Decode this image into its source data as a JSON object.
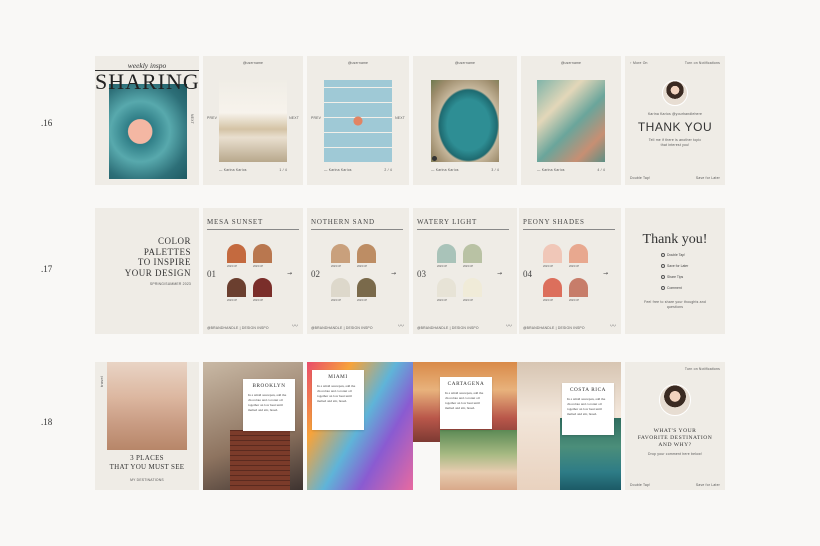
{
  "rows": [
    {
      "label": ".16"
    },
    {
      "label": ".17"
    },
    {
      "label": ".18"
    }
  ],
  "row16": {
    "cover_script": "weekly inspo",
    "cover_title": "SHARING",
    "handles": [
      "@username",
      "@username",
      "@username",
      "@username"
    ],
    "credits": [
      "— Karina Karios",
      "— Karina Karios",
      "— Karina Karios",
      "— Karina Karios"
    ],
    "pages": [
      "1 / 4",
      "2 / 4",
      "3 / 4",
      "4 / 4"
    ],
    "nav_prev": "PREV",
    "nav_next": "NEXT",
    "end": {
      "more_on": "More On",
      "notifications": "Turn on Notifications",
      "author": "Karina Karios @yourhandlehere",
      "title": "THANK YOU",
      "sub": "Tell me if there is another topic that interest you!",
      "double_tap": "Double Tap!",
      "save_later": "Save for Later"
    }
  },
  "row17": {
    "cover_title_lines": [
      "COLOR",
      "PALETTES",
      "TO INSPIRE",
      "YOUR DESIGN"
    ],
    "cover_season": "SPRING/SUMMER 2023",
    "palettes": [
      {
        "name": "MESA SUNSET",
        "num": "01",
        "colors": [
          "#c46a3f",
          "#b9774f",
          "#6b3f2f",
          "#7a2e2a"
        ]
      },
      {
        "name": "NOTHERN SAND",
        "num": "02",
        "colors": [
          "#c9a07c",
          "#bd8d64",
          "#ddd8cb",
          "#7a6a4b"
        ]
      },
      {
        "name": "WATERY LIGHT",
        "num": "03",
        "colors": [
          "#a9c3b9",
          "#b9c2a4",
          "#e7e3d6",
          "#f0ebd8"
        ]
      },
      {
        "name": "PEONY SHADES",
        "num": "04",
        "colors": [
          "#f0c7b8",
          "#e8a88f",
          "#dc6f5c",
          "#c77d6a"
        ]
      }
    ],
    "swatch_code": "2023 CP",
    "footer": "@BRANDHANDLE | DESIGN INSPO",
    "end": {
      "title": "Thank you!",
      "items": [
        "Double Tap!",
        "Save for Later",
        "Share Tips",
        "Comment"
      ],
      "note": "Feel free to share your thoughts and questions"
    }
  },
  "row18": {
    "side_label": "travel",
    "cover_title_lines": [
      "3 PLACES",
      "THAT YOU MUST SEE"
    ],
    "cover_sub": "MY DESTINATIONS",
    "cards": [
      {
        "title": "BROOKLYN",
        "body": "In a small saucepan, add the chocolate and coconut oil together on low heat until melted and stir, breed."
      },
      {
        "title": "MIAMI",
        "body": "In a small saucepan, add the chocolate and coconut oil together on low heat until melted and stir, breed."
      },
      {
        "title": "CARTAGENA",
        "body": "In a small saucepan, add the chocolate and coconut oil together on low heat until melted and stir, breed."
      },
      {
        "title": "COSTA RICA",
        "body": "In a small saucepan, add the chocolate and coconut oil together on low heat until melted and stir, breed."
      }
    ],
    "end": {
      "notifications": "Turn on Notifications",
      "title_lines": [
        "WHAT'S YOUR",
        "FAVORITE DESTINATION",
        "AND WHY?"
      ],
      "sub": "Drop your comment here below!",
      "double_tap": "Double Tap!",
      "save_later": "Save for Later"
    }
  }
}
